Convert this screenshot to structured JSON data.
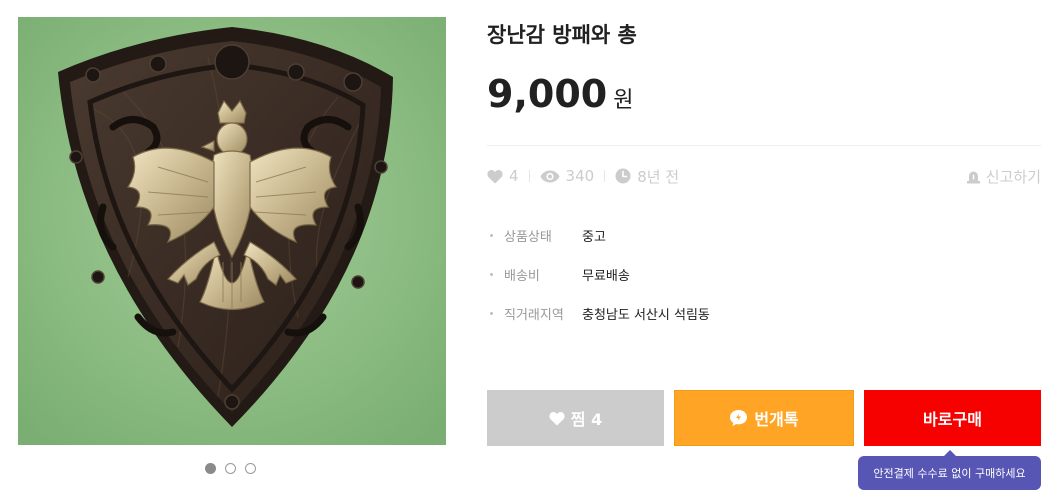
{
  "product": {
    "title": "장난감 방패와 총",
    "image_alt": "상품 이미지",
    "price_value": "9,000",
    "price_unit": "원"
  },
  "gallery": {
    "dots": 3,
    "active_index": 0
  },
  "stats": {
    "likes": "4",
    "views": "340",
    "time": "8년 전"
  },
  "report": {
    "label": "신고하기"
  },
  "details": [
    {
      "label": "상품상태",
      "value": "중고"
    },
    {
      "label": "배송비",
      "value": "무료배송"
    },
    {
      "label": "직거래지역",
      "value": "충청남도 서산시 석림동"
    }
  ],
  "actions": {
    "wish_label": "찜 4",
    "chat_label": "번개톡",
    "buy_label": "바로구매"
  },
  "tooltip": {
    "text": "안전결제 수수료 없이 구매하세요"
  },
  "colors": {
    "wish_button": "#cccccc",
    "chat_button": "#ffa425",
    "buy_button": "#f70000",
    "tooltip": "#5856b4",
    "muted_text": "#cccccc"
  },
  "icons": {
    "likes": "heart-icon",
    "views": "eye-icon",
    "time": "clock-icon",
    "report": "siren-icon",
    "chat": "chat-bubble-icon"
  }
}
